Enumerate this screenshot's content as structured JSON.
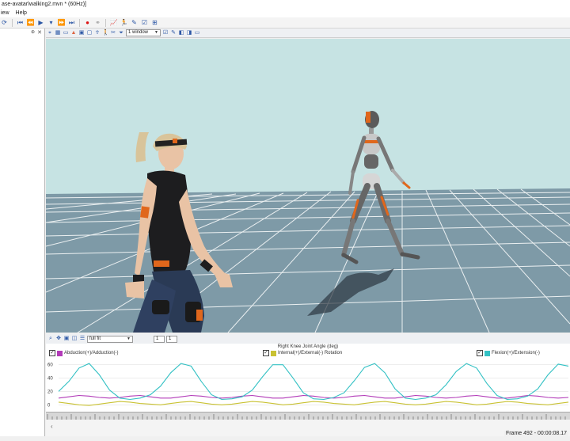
{
  "window": {
    "title": "ase-avatar\\walking2.mvn * (60Hz)]"
  },
  "menu": {
    "items": [
      "iew",
      "Help"
    ]
  },
  "viewport_toolbar": {
    "view_select": "1 window"
  },
  "graph_toolbar": {
    "fit_select": "full fit",
    "field_a": "1",
    "field_b": "1"
  },
  "graph": {
    "title": "Right Knee Joint Angle (deg)",
    "legend": [
      {
        "label": "Abduction(+)/Adduction(-)",
        "color": "#b23ab8"
      },
      {
        "label": "Internal(+)/External(-) Rotation",
        "color": "#c9c233"
      },
      {
        "label": "Flexion(+)/Extension(-)",
        "color": "#33c1c4"
      }
    ],
    "y_ticks": [
      "60",
      "40",
      "20",
      "0"
    ]
  },
  "status": {
    "frame": "Frame 492 - 00:00:08.17"
  },
  "colors": {
    "sky": "#c6e3e3",
    "floor": "#7e9aa7",
    "grid": "#ffffff",
    "accent": "#e0671c"
  },
  "chart_data": {
    "type": "line",
    "title": "Right Knee Joint Angle (deg)",
    "xlabel": "",
    "ylabel": "",
    "ylim": [
      -8,
      68
    ],
    "x": [
      0,
      1,
      2,
      3,
      4,
      5,
      6,
      7,
      8,
      9,
      10,
      11,
      12,
      13,
      14,
      15,
      16,
      17,
      18,
      19,
      20,
      21,
      22,
      23,
      24,
      25,
      26,
      27,
      28,
      29,
      30,
      31,
      32,
      33,
      34,
      35,
      36,
      37,
      38,
      39,
      40,
      41,
      42,
      43,
      44,
      45,
      46,
      47,
      48,
      49,
      50
    ],
    "series": [
      {
        "name": "Abduction(+)/Adduction(-)",
        "values": [
          10,
          12,
          14,
          13,
          11,
          10,
          11,
          13,
          14,
          12,
          10,
          10,
          12,
          14,
          13,
          11,
          10,
          11,
          13,
          14,
          12,
          10,
          10,
          12,
          14,
          13,
          11,
          10,
          11,
          13,
          14,
          12,
          10,
          10,
          12,
          14,
          13,
          11,
          10,
          11,
          13,
          14,
          12,
          10,
          10,
          12,
          14,
          13,
          11,
          10,
          11
        ]
      },
      {
        "name": "Internal(+)/External(-) Rotation",
        "values": [
          4,
          2,
          0,
          -1,
          1,
          3,
          5,
          4,
          2,
          1,
          0,
          2,
          4,
          5,
          3,
          1,
          0,
          1,
          3,
          5,
          4,
          2,
          0,
          1,
          3,
          5,
          4,
          2,
          1,
          0,
          2,
          4,
          5,
          3,
          1,
          0,
          1,
          3,
          5,
          4,
          2,
          0,
          1,
          3,
          5,
          4,
          2,
          1,
          0,
          2,
          4
        ]
      },
      {
        "name": "Flexion(+)/Extension(-)",
        "values": [
          20,
          35,
          55,
          62,
          45,
          22,
          10,
          8,
          10,
          15,
          28,
          48,
          62,
          58,
          35,
          15,
          8,
          9,
          12,
          22,
          42,
          60,
          60,
          40,
          18,
          9,
          8,
          11,
          18,
          36,
          56,
          62,
          48,
          24,
          10,
          8,
          10,
          15,
          30,
          50,
          62,
          55,
          32,
          14,
          8,
          9,
          13,
          24,
          45,
          61,
          58
        ]
      }
    ]
  }
}
